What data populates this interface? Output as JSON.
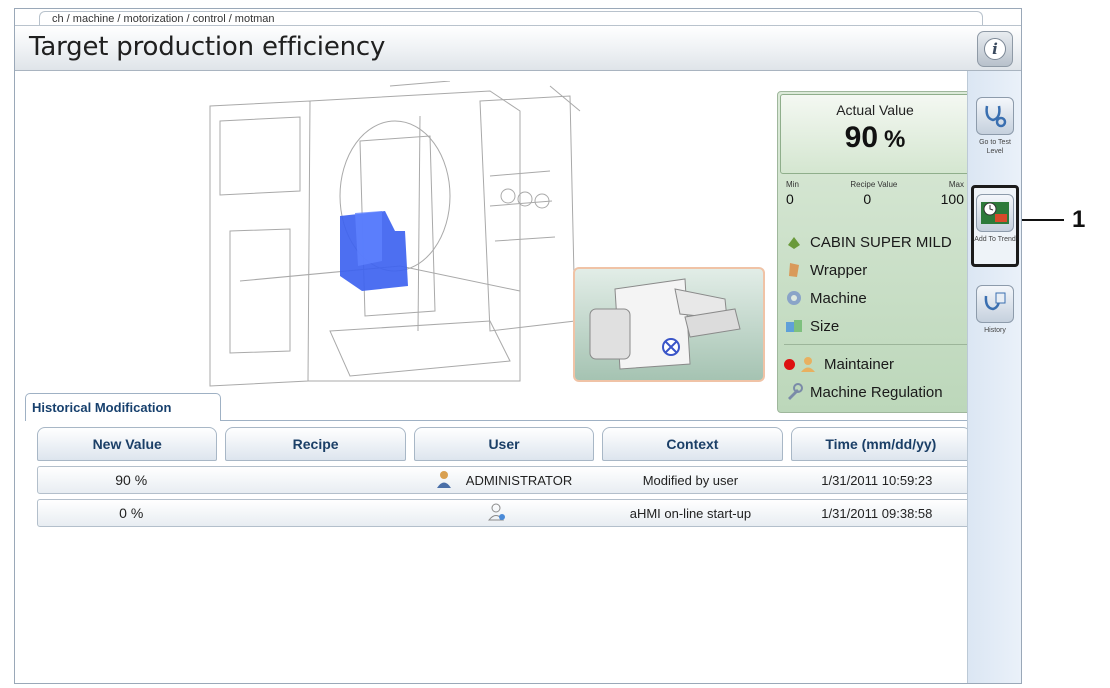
{
  "breadcrumb": "ch / machine / motorization / control / motman",
  "page_title": "Target production efficiency",
  "sidebar": {
    "buttons": [
      {
        "label": "Go to Test Level",
        "icon": "stethoscope-icon"
      },
      {
        "label": "Add To Trend",
        "icon": "clock-image-icon"
      },
      {
        "label": "History",
        "icon": "history-stethoscope-icon"
      }
    ]
  },
  "callout": "1",
  "actual": {
    "label": "Actual Value",
    "value": "90",
    "unit": "%"
  },
  "limits": {
    "min_label": "Min",
    "recipe_label": "Recipe Value",
    "max_label": "Max",
    "min": "0",
    "recipe": "0",
    "max": "100"
  },
  "info": [
    {
      "label": "CABIN SUPER MILD",
      "icon": "product-icon"
    },
    {
      "label": "Wrapper",
      "icon": "wrapper-icon"
    },
    {
      "label": "Machine",
      "icon": "gear-icon"
    },
    {
      "label": "Size",
      "icon": "size-icon"
    },
    {
      "label": "Maintainer",
      "icon": "user-icon",
      "status_color": "#dd1111"
    },
    {
      "label": "Machine Regulation",
      "icon": "wrench-icon"
    }
  ],
  "tab": "Historical Modification",
  "table": {
    "headers": [
      "New Value",
      "Recipe",
      "User",
      "Context",
      "Time (mm/dd/yy)"
    ],
    "rows": [
      {
        "new_value": "90 %",
        "recipe": "",
        "user": "ADMINISTRATOR",
        "context": "Modified by user",
        "time": "1/31/2011 10:59:23"
      },
      {
        "new_value": "0 %",
        "recipe": "",
        "user": "",
        "context": "aHMI on-line start-up",
        "time": "1/31/2011 09:38:58"
      }
    ]
  },
  "colors": {
    "panel_green": "#bcd7ba",
    "header_text": "#1b3f67",
    "maintainer_dot": "#dd1111"
  }
}
